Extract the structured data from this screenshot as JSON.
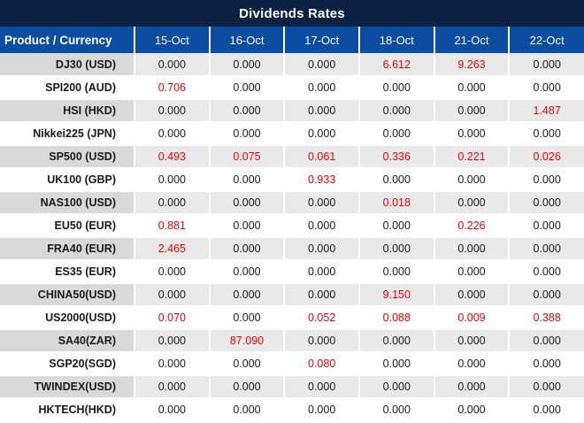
{
  "title": "Dividends Rates",
  "colors": {
    "title_bar_bg": "#0D2242",
    "header_bg": "#0B4DA1",
    "header_text": "#FFFFFF",
    "stripe_product_bg": "#D9D9D9",
    "stripe_value_bg": "#E9E9E9",
    "white_row_bg": "#FFFFFF",
    "value_black": "#1A1A1A",
    "value_red": "#EE0000",
    "gridline": "#FFFFFF"
  },
  "chart_data": {
    "type": "table",
    "title": "Dividends Rates",
    "columns": [
      "Product / Currency",
      "15-Oct",
      "16-Oct",
      "17-Oct",
      "18-Oct",
      "21-Oct",
      "22-Oct"
    ],
    "rows": [
      {
        "product": "DJ30 (USD)",
        "values": [
          "0.000",
          "0.000",
          "0.000",
          "6.612",
          "9.263",
          "0.000"
        ],
        "red_value_indexes": [
          3,
          4
        ]
      },
      {
        "product": "SPI200 (AUD)",
        "values": [
          "0.706",
          "0.000",
          "0.000",
          "0.000",
          "0.000",
          "0.000"
        ],
        "red_value_indexes": [
          0
        ]
      },
      {
        "product": "HSI (HKD)",
        "values": [
          "0.000",
          "0.000",
          "0.000",
          "0.000",
          "0.000",
          "1.487"
        ],
        "red_value_indexes": [
          5
        ]
      },
      {
        "product": "Nikkei225 (JPN)",
        "values": [
          "0.000",
          "0.000",
          "0.000",
          "0.000",
          "0.000",
          "0.000"
        ],
        "red_value_indexes": []
      },
      {
        "product": "SP500 (USD)",
        "values": [
          "0.493",
          "0.075",
          "0.061",
          "0.336",
          "0.221",
          "0.026"
        ],
        "red_value_indexes": [
          0,
          1,
          2,
          3,
          4,
          5
        ]
      },
      {
        "product": "UK100 (GBP)",
        "values": [
          "0.000",
          "0.000",
          "0.933",
          "0.000",
          "0.000",
          "0.000"
        ],
        "red_value_indexes": [
          2
        ]
      },
      {
        "product": "NAS100 (USD)",
        "values": [
          "0.000",
          "0.000",
          "0.000",
          "0.018",
          "0.000",
          "0.000"
        ],
        "red_value_indexes": [
          3
        ]
      },
      {
        "product": "EU50 (EUR)",
        "values": [
          "0.881",
          "0.000",
          "0.000",
          "0.000",
          "0.226",
          "0.000"
        ],
        "red_value_indexes": [
          0,
          4
        ]
      },
      {
        "product": "FRA40 (EUR)",
        "values": [
          "2.465",
          "0.000",
          "0.000",
          "0.000",
          "0.000",
          "0.000"
        ],
        "red_value_indexes": [
          0
        ]
      },
      {
        "product": "ES35 (EUR)",
        "values": [
          "0.000",
          "0.000",
          "0.000",
          "0.000",
          "0.000",
          "0.000"
        ],
        "red_value_indexes": []
      },
      {
        "product": "CHINA50(USD)",
        "values": [
          "0.000",
          "0.000",
          "0.000",
          "9.150",
          "0.000",
          "0.000"
        ],
        "red_value_indexes": [
          3
        ]
      },
      {
        "product": "US2000(USD)",
        "values": [
          "0.070",
          "0.000",
          "0.052",
          "0.088",
          "0.009",
          "0.388"
        ],
        "red_value_indexes": [
          0,
          2,
          3,
          4,
          5
        ]
      },
      {
        "product": "SA40(ZAR)",
        "values": [
          "0.000",
          "87.090",
          "0.000",
          "0.000",
          "0.000",
          "0.000"
        ],
        "red_value_indexes": [
          1
        ]
      },
      {
        "product": "SGP20(SGD)",
        "values": [
          "0.000",
          "0.000",
          "0.080",
          "0.000",
          "0.000",
          "0.000"
        ],
        "red_value_indexes": [
          2
        ]
      },
      {
        "product": "TWINDEX(USD)",
        "values": [
          "0.000",
          "0.000",
          "0.000",
          "0.000",
          "0.000",
          "0.000"
        ],
        "red_value_indexes": []
      },
      {
        "product": "HKTECH(HKD)",
        "values": [
          "0.000",
          "0.000",
          "0.000",
          "0.000",
          "0.000",
          "0.000"
        ],
        "red_value_indexes": []
      }
    ]
  }
}
